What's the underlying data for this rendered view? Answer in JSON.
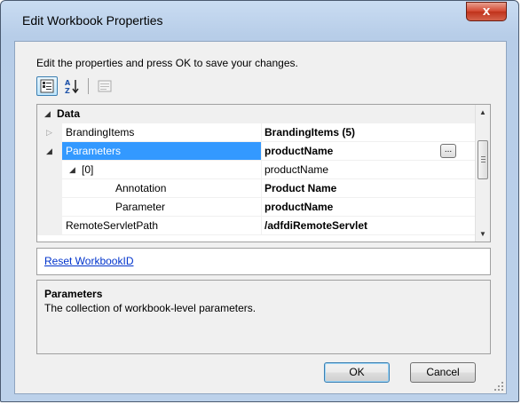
{
  "window": {
    "title": "Edit Workbook Properties",
    "close_label": "x"
  },
  "instruction": "Edit the properties and press OK to save your changes.",
  "toolbar": {
    "categorized_icon": "categorized-view-icon",
    "alphabetical_icon": "alphabetical-sort-icon",
    "property_pages_icon": "property-pages-icon"
  },
  "grid": {
    "category": "Data",
    "rows": [
      {
        "name": "BrandingItems",
        "value": "BrandingItems (5)",
        "value_bold": true
      },
      {
        "name": "Parameters",
        "value": "productName",
        "value_bold": true,
        "selected": true,
        "ellipsis": "..."
      },
      {
        "name": "[0]",
        "value": "productName",
        "value_bold": false
      },
      {
        "name": "Annotation",
        "value": "Product Name",
        "value_bold": true
      },
      {
        "name": "Parameter",
        "value": "productName",
        "value_bold": true
      },
      {
        "name": "RemoteServletPath",
        "value": "/adfdiRemoteServlet",
        "value_bold": true
      }
    ]
  },
  "commands": {
    "reset_link": "Reset WorkbookID"
  },
  "help": {
    "title": "Parameters",
    "description": "The collection of workbook-level parameters."
  },
  "buttons": {
    "ok": "OK",
    "cancel": "Cancel"
  },
  "colors": {
    "selection": "#3399ff",
    "link": "#0033cc",
    "close": "#c0321a"
  }
}
